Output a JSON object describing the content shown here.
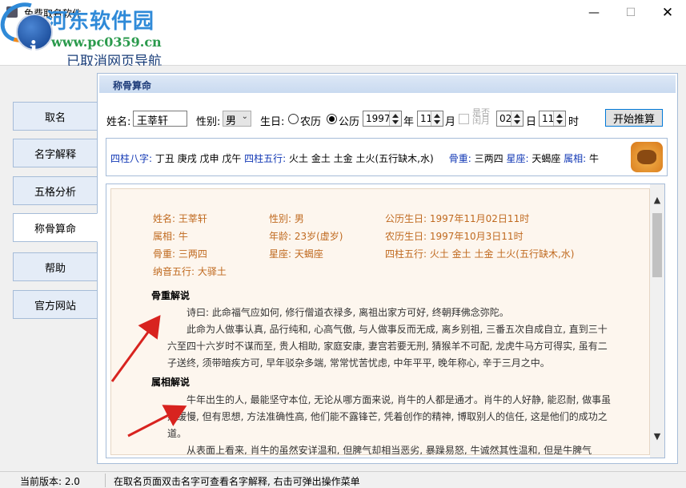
{
  "window": {
    "title": "免费取名软件",
    "minimize_glyph": "—",
    "maximize_glyph": "☐",
    "close_glyph": "✕"
  },
  "banner": {
    "logo_letter": "i",
    "text": "已取消网页导航",
    "watermark_name": "河东软件园",
    "watermark_url": "www.pc0359.cn"
  },
  "nav": {
    "items": [
      {
        "label": "取名"
      },
      {
        "label": "名字解释"
      },
      {
        "label": "五格分析"
      },
      {
        "label": "称骨算命"
      },
      {
        "label": "帮助"
      },
      {
        "label": "官方网站"
      }
    ],
    "active_index": 3
  },
  "panel": {
    "title": "称骨算命"
  },
  "form": {
    "name_label": "姓名:",
    "name_value": "王莘轩",
    "gender_label": "性别:",
    "gender_value": "男",
    "birthday_label": "生日:",
    "lunar_label": "农历",
    "solar_label": "公历",
    "calendar_selected": "公历",
    "year_value": "1997",
    "year_unit": "年",
    "month_value": "11",
    "month_unit": "月",
    "leap_label": "是否闰月",
    "day_value": "02",
    "day_unit": "日",
    "hour_value": "11",
    "hour_unit": "时",
    "start_button": "开始推算"
  },
  "summary": {
    "bazi_label": "四柱八字:",
    "bazi_value": "丁丑 庚戌 戊申 戊午",
    "wuxing_label": "四柱五行:",
    "wuxing_value": "火土 金土 土金 土火(五行缺木,水)",
    "bone_label": "骨重:",
    "bone_value": "三两四",
    "star_label": "星座:",
    "star_value": "天蝎座",
    "zodiac_label": "属相:",
    "zodiac_value": "牛",
    "zodiac_icon": "ox-icon"
  },
  "detail": {
    "info": {
      "name": "姓名: 王莘轩",
      "gender": "性别: 男",
      "solar_birth": "公历生日: 1997年11月02日11时",
      "zodiac": "属相: 牛",
      "age": "年龄: 23岁(虚岁)",
      "lunar_birth": "农历生日: 1997年10月3日11时",
      "bone": "骨重: 三两四",
      "star": "星座: 天蝎座",
      "wuxing": "四柱五行: 火土 金土 土金 土火(五行缺木,水)",
      "nayin": "纳音五行: 大驿土"
    },
    "bone_title": "骨重解说",
    "bone_poem": "诗曰: 此命福气应如何, 修行僧道衣禄多, 离祖出家方可好, 终朝拜佛念弥陀。",
    "bone_text": "此命为人做事认真, 品行纯和, 心高气傲, 与人做事反而无成, 离乡别祖, 三番五次自成自立, 直到三十六至四十六岁时不谋而至, 贵人相助, 家庭安康, 妻宫若要无刑, 猜猴羊不可配, 龙虎牛马方可得实, 虽有二子送终, 须带暗疾方可, 早年驳杂多端, 常常忧苦忧虑, 中年平平, 晚年称心, 辛于三月之中。",
    "zodiac_title": "属相解说",
    "zodiac_text": "牛年出生的人, 最能坚守本位, 无论从哪方面来说, 肖牛的人都是通才。肖牛的人好静, 能忍耐, 做事虽然缓慢, 但有思想, 方法准确性高, 他们能不露锋芒, 凭着创作的精神, 博取别人的信任, 这是他们的成功之道。",
    "zodiac_text2": "从表面上看来, 肖牛的虽然安详温和, 但脾气却相当恶劣, 暴躁易怒, 牛诚然其性温和, 但是牛脾气"
  },
  "scroll": {
    "up_glyph": "▲",
    "down_glyph": "▼"
  },
  "status": {
    "version": "当前版本: 2.0",
    "hint": "在取名页面双击名字可查看名字解释, 右击可弹出操作菜单"
  },
  "colors": {
    "accent_blue": "#1238b5",
    "info_orange": "#c06a20",
    "arrow_red": "#d8231f"
  }
}
